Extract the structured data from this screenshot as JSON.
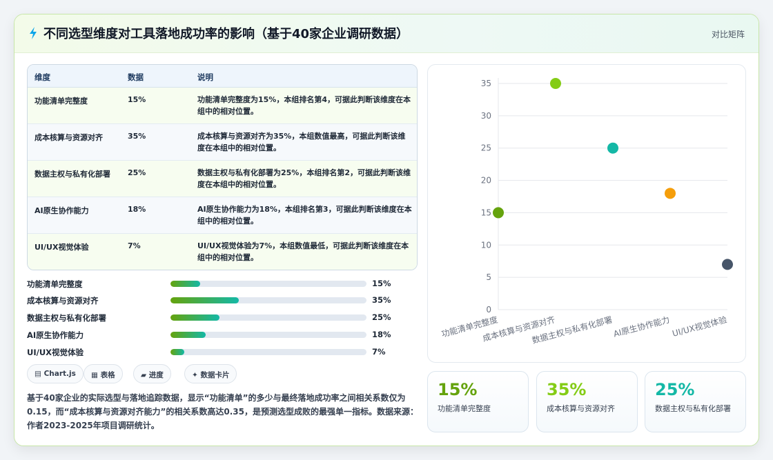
{
  "header": {
    "title": "不同选型维度对工具落地成功率的影响（基于40家企业调研数据）",
    "mode_label": "对比矩阵"
  },
  "table": {
    "headers": [
      "维度",
      "数据",
      "说明"
    ],
    "rows": [
      {
        "dimension": "功能清单完整度",
        "value": "15%",
        "desc": "功能清单完整度为15%，本组排名第4，可据此判断该维度在本组中的相对位置。"
      },
      {
        "dimension": "成本核算与资源对齐",
        "value": "35%",
        "desc": "成本核算与资源对齐为35%，本组数值最高，可据此判断该维度在本组中的相对位置。"
      },
      {
        "dimension": "数据主权与私有化部署",
        "value": "25%",
        "desc": "数据主权与私有化部署为25%，本组排名第2，可据此判断该维度在本组中的相对位置。"
      },
      {
        "dimension": "AI原生协作能力",
        "value": "18%",
        "desc": "AI原生协作能力为18%，本组排名第3，可据此判断该维度在本组中的相对位置。"
      },
      {
        "dimension": "UI/UX视觉体验",
        "value": "7%",
        "desc": "UI/UX视觉体验为7%，本组数值最低，可据此判断该维度在本组中的相对位置。"
      }
    ]
  },
  "progress": [
    {
      "label": "功能清单完整度",
      "value": 15,
      "text": "15%"
    },
    {
      "label": "成本核算与资源对齐",
      "value": 35,
      "text": "35%"
    },
    {
      "label": "数据主权与私有化部署",
      "value": 25,
      "text": "25%"
    },
    {
      "label": "AI原生协作能力",
      "value": 18,
      "text": "18%"
    },
    {
      "label": "UI/UX视觉体验",
      "value": 7,
      "text": "7%"
    }
  ],
  "tags": [
    "▤ Chart.js",
    "▦ 表格",
    "▰ 进度",
    "✦ 数据卡片"
  ],
  "note": "基于40家企业的实际选型与落地追踪数据，显示“功能清单”的多少与最终落地成功率之间相关系数仅为0.15，而“成本核算与资源对齐能力”的相关系数高达0.35，是预测选型成败的最强单一指标。数据来源：作者2023-2025年项目调研统计。",
  "stats": [
    {
      "value": "15%",
      "label": "功能清单完整度",
      "color": "#65a30d"
    },
    {
      "value": "35%",
      "label": "成本核算与资源对齐",
      "color": "#84cc16"
    },
    {
      "value": "25%",
      "label": "数据主权与私有化部署",
      "color": "#14b8a6"
    }
  ],
  "colors": {
    "accent": "#65a30d",
    "teal": "#14b8a6"
  },
  "chart_data": {
    "type": "scatter",
    "categories": [
      "功能清单完整度",
      "成本核算与资源对齐",
      "数据主权与私有化部署",
      "AI原生协作能力",
      "UI/UX视觉体验"
    ],
    "values": [
      15,
      35,
      25,
      18,
      7
    ],
    "colors": [
      "#65a30d",
      "#84cc16",
      "#14b8a6",
      "#f59e0b",
      "#475569"
    ],
    "yticks": [
      0,
      5,
      10,
      15,
      20,
      25,
      30,
      35
    ],
    "ylim": [
      0,
      35
    ],
    "grid": true,
    "legend": false,
    "title": "",
    "xlabel": "",
    "ylabel": ""
  }
}
